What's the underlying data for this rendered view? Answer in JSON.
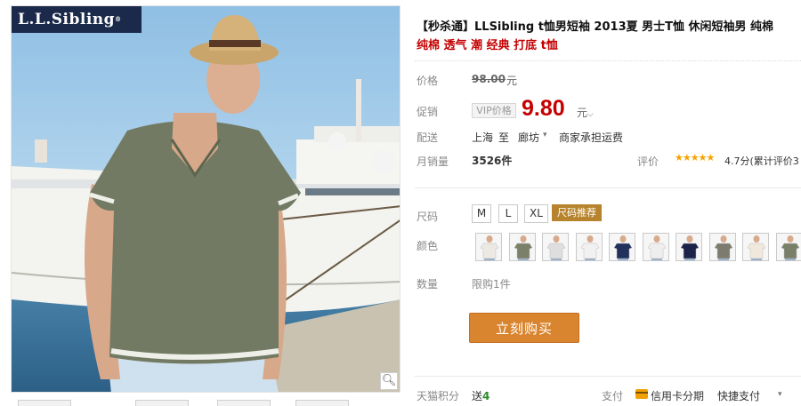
{
  "gallery": {
    "logo_text": "L.L.Sibling",
    "logo_mark": "®",
    "zoom_icon": "magnifier-icon"
  },
  "product": {
    "title": "【秒杀通】LLSibling t恤男短袖 2013夏 男士T恤 休闲短袖男 纯棉",
    "subtitle": "纯棉 透气 潮 经典 打底 t恤"
  },
  "price": {
    "label": "价格",
    "original": "98.00",
    "unit": "元"
  },
  "promo": {
    "label": "促销",
    "vip_tag": "VIP价格",
    "price": "9.80",
    "unit": "元"
  },
  "shipping": {
    "label": "配送",
    "from": "上海",
    "to": "至",
    "city": "廊坊",
    "fee": "商家承担运费"
  },
  "sales": {
    "label": "月销量",
    "count": "3526件",
    "rating_label": "评价",
    "rating_stars": "★★★★★",
    "rating_text": "4.7分(累计评价3"
  },
  "size": {
    "label": "尺码",
    "options": [
      "M",
      "L",
      "XL"
    ],
    "recommend": "尺码推荐"
  },
  "color": {
    "label": "颜色",
    "swatches": [
      "#ece9e4",
      "#7b8068",
      "#dedede",
      "#f1f1f1",
      "#22305c",
      "#eeeeee",
      "#1c2348",
      "#7d7b6e",
      "#f0e8dc",
      "#7a7f6a"
    ]
  },
  "quantity": {
    "label": "数量",
    "limit": "限购1件"
  },
  "buy": {
    "label": "立刻购买"
  },
  "points": {
    "label": "天猫积分",
    "prefix": "送",
    "value": "4"
  },
  "payment": {
    "label": "支付",
    "card": "信用卡分期",
    "quick": "快捷支付"
  },
  "colors": {
    "price_red": "#c40000",
    "buy_orange": "#d9852f",
    "logo_navy": "#1b2a4a"
  }
}
